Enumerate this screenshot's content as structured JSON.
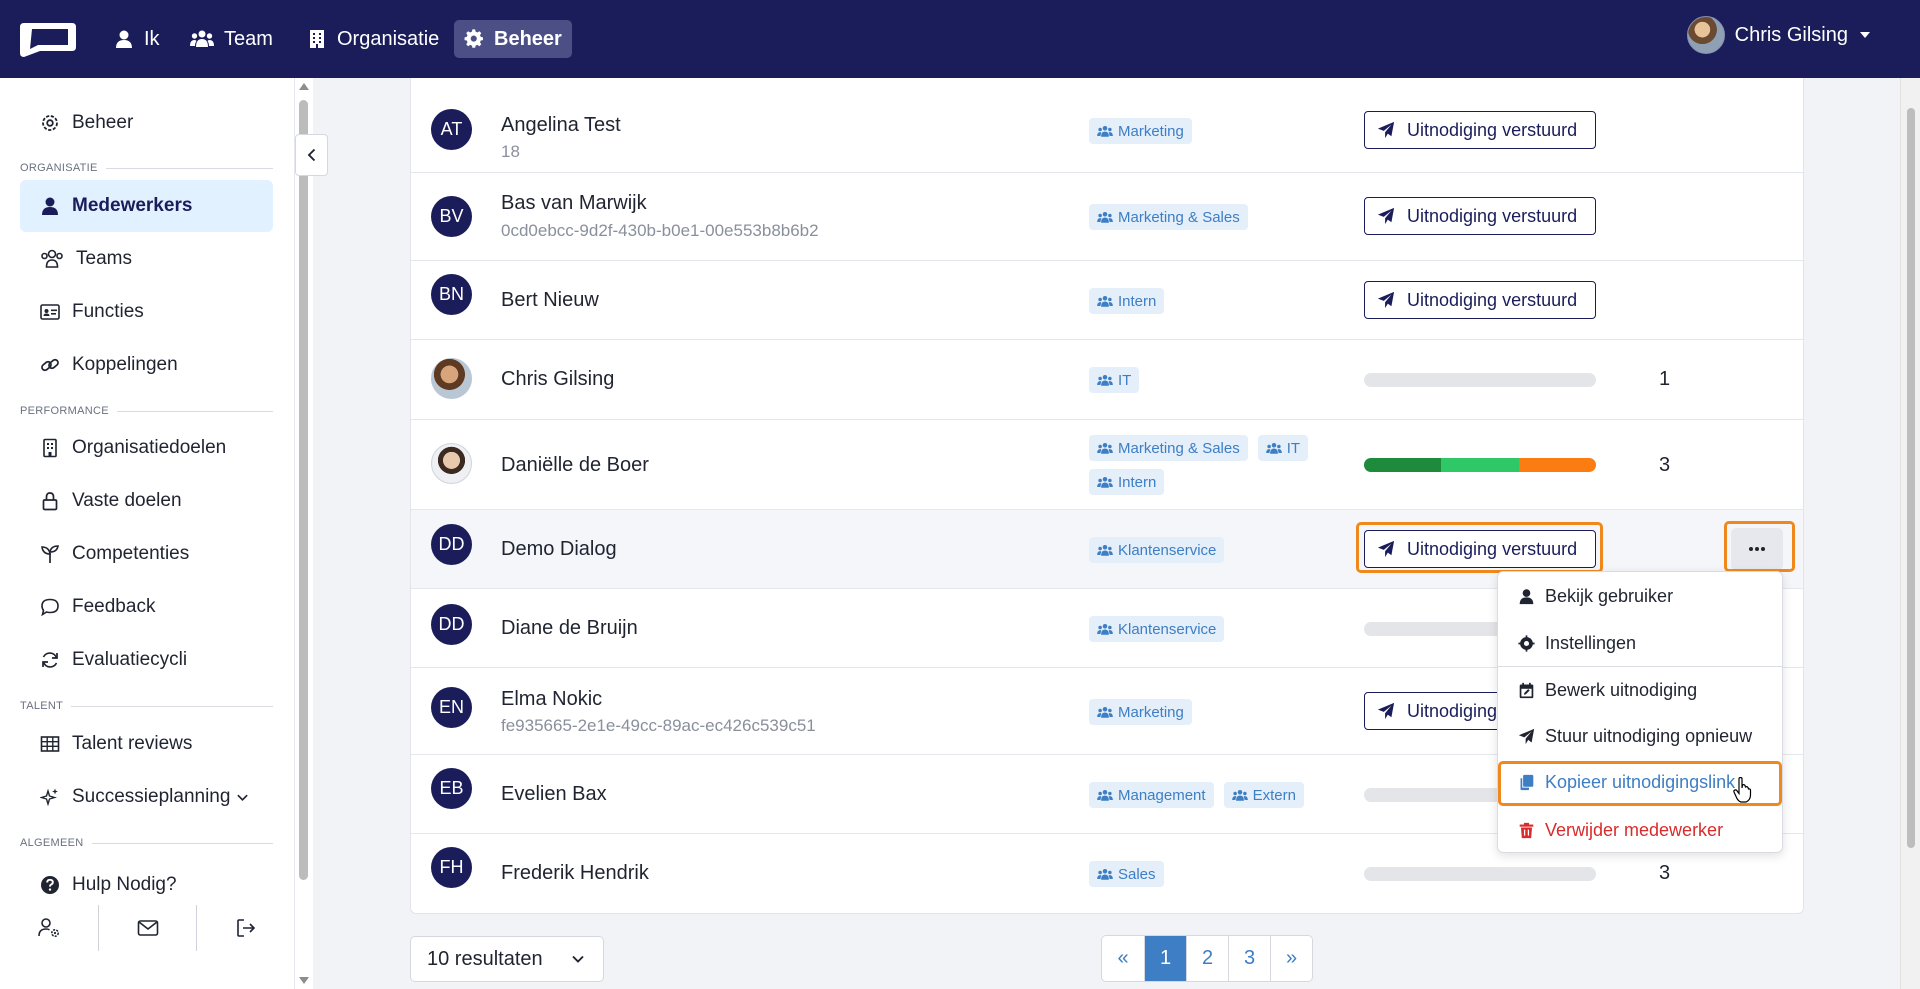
{
  "topnav": {
    "items": [
      {
        "label": "Ik",
        "icon": "user-icon"
      },
      {
        "label": "Team",
        "icon": "users-icon"
      },
      {
        "label": "Organisatie",
        "icon": "building-icon"
      },
      {
        "label": "Beheer",
        "icon": "gear-icon",
        "active": true
      }
    ],
    "user_name": "Chris Gilsing"
  },
  "sidebar": {
    "top_item": "Beheer",
    "sections": [
      {
        "heading": "ORGANISATIE",
        "items": [
          "Medewerkers",
          "Teams",
          "Functies",
          "Koppelingen"
        ]
      },
      {
        "heading": "PERFORMANCE",
        "items": [
          "Organisatiedoelen",
          "Vaste doelen",
          "Competenties",
          "Feedback",
          "Evaluatiecycli"
        ]
      },
      {
        "heading": "TALENT",
        "items": [
          "Talent reviews",
          "Successieplanning"
        ]
      },
      {
        "heading": "ALGEMEEN",
        "items": [
          "Hulp Nodig?"
        ]
      }
    ],
    "active_item": "Medewerkers"
  },
  "employees": [
    {
      "initials": "AT",
      "name": "Angelina Test",
      "sub": "18",
      "tags": [
        "Marketing"
      ],
      "status": "invite",
      "invite_label": "Uitnodiging verstuurd"
    },
    {
      "initials": "BV",
      "name": "Bas van Marwijk",
      "sub": "0cd0ebcc-9d2f-430b-b0e1-00e553b8b6b2",
      "tags": [
        "Marketing & Sales"
      ],
      "status": "invite",
      "invite_label": "Uitnodiging verstuurd"
    },
    {
      "initials": "BN",
      "name": "Bert Nieuw",
      "sub": "",
      "tags": [
        "Intern"
      ],
      "status": "invite",
      "invite_label": "Uitnodiging verstuurd"
    },
    {
      "initials": "",
      "name": "Chris Gilsing",
      "sub": "",
      "tags": [
        "IT"
      ],
      "status": "progress",
      "count": "1"
    },
    {
      "initials": "",
      "name": "Daniëlle de Boer",
      "sub": "",
      "tags": [
        "Marketing & Sales",
        "IT",
        "Intern"
      ],
      "status": "progress",
      "count": "3"
    },
    {
      "initials": "DD",
      "name": "Demo Dialog",
      "sub": "",
      "tags": [
        "Klantenservice"
      ],
      "status": "invite",
      "invite_label": "Uitnodiging verstuurd"
    },
    {
      "initials": "DD",
      "name": "Diane de Bruijn",
      "sub": "",
      "tags": [
        "Klantenservice"
      ],
      "status": "progress",
      "count": ""
    },
    {
      "initials": "EN",
      "name": "Elma Nokic",
      "sub": "fe935665-2e1e-49cc-89ac-ec426c539c51",
      "tags": [
        "Marketing"
      ],
      "status": "invite",
      "invite_label": "Uitnodiging verstuurd"
    },
    {
      "initials": "EB",
      "name": "Evelien Bax",
      "sub": "",
      "tags": [
        "Management",
        "Extern"
      ],
      "status": "progress",
      "count": ""
    },
    {
      "initials": "FH",
      "name": "Frederik Hendrik",
      "sub": "",
      "tags": [
        "Sales"
      ],
      "status": "progress",
      "count": "3"
    }
  ],
  "progress_segments_danielle": [
    {
      "fraction": 0.333,
      "color": "#1e8a3c"
    },
    {
      "fraction": 0.333,
      "color": "#2ec866"
    },
    {
      "fraction": 0.334,
      "color": "#fb7d12"
    }
  ],
  "dropdown": {
    "items": [
      {
        "label": "Bekijk gebruiker",
        "icon": "user-icon"
      },
      {
        "label": "Instellingen",
        "icon": "gear-icon"
      },
      {
        "label": "Bewerk uitnodiging",
        "icon": "calendar-edit-icon"
      },
      {
        "label": "Stuur uitnodiging opnieuw",
        "icon": "paper-plane-icon"
      },
      {
        "label": "Kopieer uitnodigingslink",
        "icon": "copy-icon"
      },
      {
        "label": "Verwijder medewerker",
        "icon": "trash-icon"
      }
    ]
  },
  "footer": {
    "results_label": "10 resultaten",
    "pages": [
      "«",
      "1",
      "2",
      "3",
      "»"
    ],
    "active_page": "1"
  },
  "colors": {
    "navy": "#1a1d5a",
    "accent_blue": "#3d7ec4",
    "highlight_orange": "#f0891d",
    "danger_red": "#d92b2b",
    "active_sidebar_bg": "#e1f1ff"
  }
}
